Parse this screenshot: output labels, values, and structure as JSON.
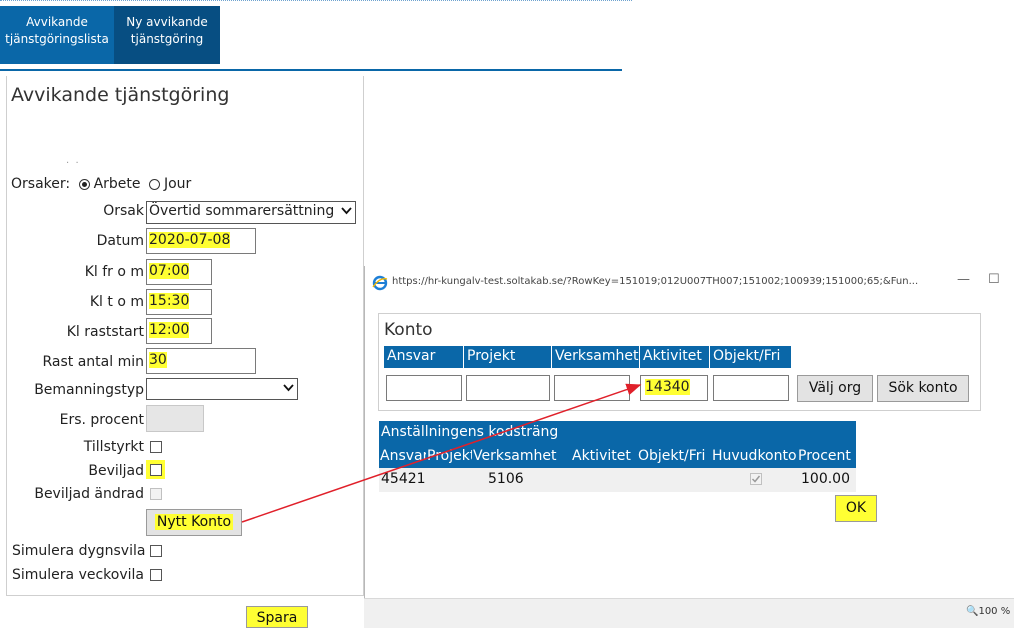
{
  "tabs": [
    {
      "line1": "Avvikande",
      "line2": "tjänstgöringslista"
    },
    {
      "line1": "Ny avvikande",
      "line2": "tjänstgöring"
    }
  ],
  "form": {
    "title": "Avvikande tjänstgöring",
    "orsaker_label": "Orsaker:",
    "radio_arbete": "Arbete",
    "radio_jour": "Jour",
    "orsak_label": "Orsak",
    "orsak_value": "Övertid sommarersättning",
    "datum_label": "Datum",
    "datum_value": "2020-07-08",
    "klfrom_label": "Kl fr o m",
    "klfrom_value": "07:00",
    "kltom_label": "Kl t o m",
    "kltom_value": "15:30",
    "rast_label": "Kl raststart",
    "rast_value": "12:00",
    "rastmin_label": "Rast antal min",
    "rastmin_value": "30",
    "bemanning_label": "Bemanningstyp",
    "bemanning_value": "",
    "ers_label": "Ers. procent",
    "tillstyrkt_label": "Tillstyrkt",
    "beviljad_label": "Beviljad",
    "beviljad_andrad_label": "Beviljad ändrad",
    "nytt_konto_label": "Nytt Konto",
    "sim_dygn_label": "Simulera dygnsvila",
    "sim_vecko_label": "Simulera veckovila",
    "spara_label": "Spara"
  },
  "dialog": {
    "url": "https://hr-kungalv-test.soltakab.se/?RowKey=151019;012U007TH007;151002;100939;151000;65;&Fun...",
    "minimize": "—",
    "maximize": "☐",
    "konto_title": "Konto",
    "konto_headers": [
      "Ansvar",
      "Projekt",
      "Verksamhet",
      "Aktivitet",
      "Objekt/Fri"
    ],
    "konto_values": [
      "",
      "",
      "",
      "14340",
      ""
    ],
    "valj_org_label": "Välj org",
    "sok_konto_label": "Sök konto",
    "emp_title": "Anställningens kodsträng",
    "emp_headers": [
      "Ansvar",
      "Projekt",
      "Verksamhet",
      "Aktivitet",
      "Objekt/Fri",
      "Huvudkonto",
      "Procent"
    ],
    "emp_row": {
      "ansvar": "45421",
      "projekt": "5106",
      "verksamhet": "",
      "aktivitet": "",
      "objekt": "",
      "huvudkonto": true,
      "procent": "100.00"
    },
    "ok_label": "OK",
    "zoom": "100 %"
  },
  "colors": {
    "accent": "#0a67a8",
    "highlight": "#ffff33",
    "arrow": "#e0202a"
  }
}
